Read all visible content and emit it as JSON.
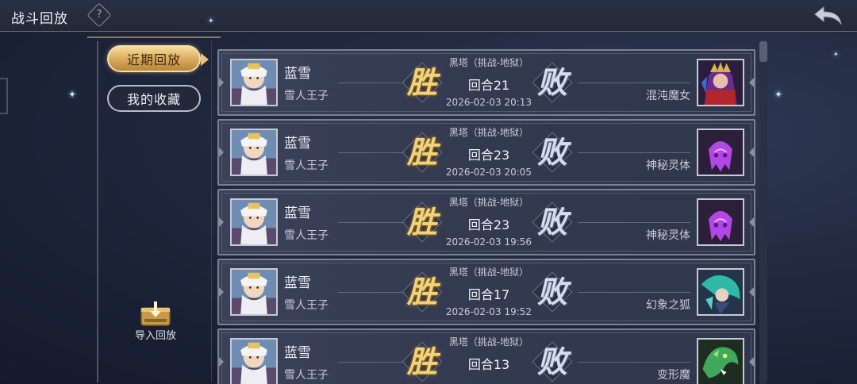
{
  "header": {
    "title": "战斗回放"
  },
  "tabs": {
    "recent": "近期回放",
    "favorites": "我的收藏"
  },
  "import": {
    "label": "导入回放"
  },
  "battles": [
    {
      "hero_name": "蓝雪",
      "hero_title": "雪人王子",
      "result_left": "胜",
      "result_right": "败",
      "stage": "黑塔（挑战-地狱）",
      "round": "回合21",
      "time": "2026-02-03 20:13",
      "enemy_name": "混沌魔女",
      "enemy_icon": "chaos-witch-portrait"
    },
    {
      "hero_name": "蓝雪",
      "hero_title": "雪人王子",
      "result_left": "胜",
      "result_right": "败",
      "stage": "黑塔（挑战-地狱）",
      "round": "回合23",
      "time": "2026-02-03 20:05",
      "enemy_name": "神秘灵体",
      "enemy_icon": "purple-spirit-portrait"
    },
    {
      "hero_name": "蓝雪",
      "hero_title": "雪人王子",
      "result_left": "胜",
      "result_right": "败",
      "stage": "黑塔（挑战-地狱）",
      "round": "回合23",
      "time": "2026-02-03 19:56",
      "enemy_name": "神秘灵体",
      "enemy_icon": "purple-spirit-portrait"
    },
    {
      "hero_name": "蓝雪",
      "hero_title": "雪人王子",
      "result_left": "胜",
      "result_right": "败",
      "stage": "黑塔（挑战-地狱）",
      "round": "回合17",
      "time": "2026-02-03 19:52",
      "enemy_name": "幻象之狐",
      "enemy_icon": "illusion-fox-portrait"
    },
    {
      "hero_name": "蓝雪",
      "hero_title": "雪人王子",
      "result_left": "胜",
      "result_right": "败",
      "stage": "黑塔（挑战-地狱）",
      "round": "回合13",
      "time": "",
      "enemy_name": "变形魔",
      "enemy_icon": "green-dragon-portrait"
    }
  ],
  "colors": {
    "accent_gold": "#e9c27a",
    "win": "#f2d27a",
    "lose": "#d6dcf0"
  }
}
